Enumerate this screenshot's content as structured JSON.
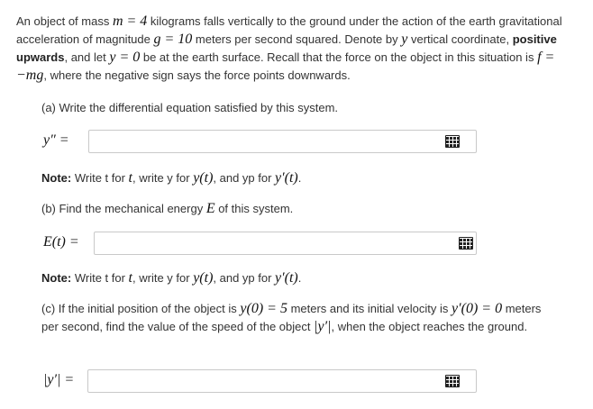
{
  "intro": {
    "t1": "An object of mass ",
    "m1": "m = 4",
    "t2": " kilograms falls vertically to the ground under the action of the earth gravitational acceleration of magnitude ",
    "m2": "g = 10",
    "t3": " meters per second squared. Denote by ",
    "m3": "y",
    "t4": " vertical coordinate, ",
    "bold": "positive upwards",
    "t5": ", and let ",
    "m4": "y = 0",
    "t6": " be at the earth surface. Recall that the force on the object in this situation is ",
    "m5": "f = −mg",
    "t7": ", where the negative sign says the force points downwards."
  },
  "part_a": {
    "prompt": "(a) Write the differential equation satisfied by this system.",
    "label": "y″ =",
    "value": "",
    "note_label": "Note:",
    "note_t1": " Write t for ",
    "note_m1": "t",
    "note_t2": ", write y for ",
    "note_m2": "y(t)",
    "note_t3": ", and yp for ",
    "note_m3": "y′(t)",
    "note_t4": "."
  },
  "part_b": {
    "prompt_t1": "(b) Find the mechanical energy ",
    "prompt_m1": "E",
    "prompt_t2": " of this system.",
    "label": "E(t) =",
    "value": "",
    "note_label": "Note:",
    "note_t1": " Write t for ",
    "note_m1": "t",
    "note_t2": ", write y for ",
    "note_m2": "y(t)",
    "note_t3": ", and yp for ",
    "note_m3": "y′(t)",
    "note_t4": "."
  },
  "part_c": {
    "t1": "(c) If the initial position of the object is ",
    "m1": "y(0) = 5",
    "t2": " meters and its initial velocity is ",
    "m2": "y′(0) = 0",
    "t3": " meters per second, find the value of the speed of the object ",
    "m3": "|y′|",
    "t4": ", when the object reaches the ground.",
    "label": "|y′| =",
    "value": ""
  },
  "icons": {
    "keyboard": "keyboard-icon"
  }
}
